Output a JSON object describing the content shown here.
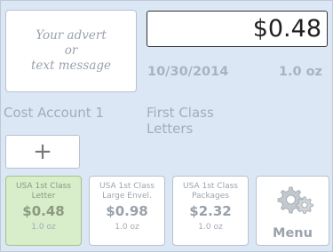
{
  "advert": {
    "line1": "Your advert",
    "line2": "or",
    "line3": "text message"
  },
  "postage": {
    "amount": "$0.48",
    "date": "10/30/2014",
    "weight": "1.0 oz"
  },
  "account": {
    "name": "Cost Account 1"
  },
  "mail_class": {
    "label": "First Class Letters"
  },
  "add_button": {
    "label": "+"
  },
  "presets": [
    {
      "line1": "USA 1st Class",
      "line2": "Letter",
      "price": "$0.48",
      "weight": "1.0 oz",
      "selected": true
    },
    {
      "line1": "USA 1st Class",
      "line2": "Large Envel.",
      "price": "$0.98",
      "weight": "1.0 oz",
      "selected": false
    },
    {
      "line1": "USA 1st Class",
      "line2": "Packages",
      "price": "$2.32",
      "weight": "1.0 oz",
      "selected": false
    }
  ],
  "menu": {
    "label": "Menu",
    "icon": "gear-icon"
  }
}
